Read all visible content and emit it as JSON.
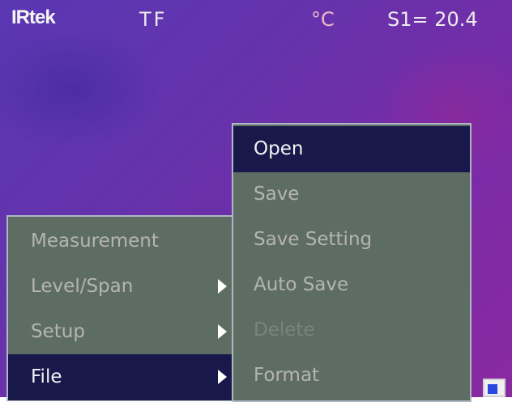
{
  "hud": {
    "logo": "IRtek",
    "mode": "TF",
    "unit": "°C",
    "spot_reading": "S1= 20.4"
  },
  "main_menu": {
    "items": [
      {
        "label": "Measurement",
        "has_submenu": false,
        "selected": false
      },
      {
        "label": "Level/Span",
        "has_submenu": true,
        "selected": false
      },
      {
        "label": "Setup",
        "has_submenu": true,
        "selected": false
      },
      {
        "label": "File",
        "has_submenu": true,
        "selected": true
      }
    ]
  },
  "file_submenu": {
    "items": [
      {
        "label": "Open",
        "selected": true,
        "enabled": true
      },
      {
        "label": "Save",
        "selected": false,
        "enabled": true
      },
      {
        "label": "Save Setting",
        "selected": false,
        "enabled": true
      },
      {
        "label": "Auto Save",
        "selected": false,
        "enabled": true
      },
      {
        "label": "Delete",
        "selected": false,
        "enabled": false
      },
      {
        "label": "Format",
        "selected": false,
        "enabled": true
      }
    ]
  },
  "colors": {
    "menu_background": "#5e6d63",
    "menu_border": "#aeb8c4",
    "selection_background": "#19184b",
    "text_normal": "#b4b4b4",
    "text_selected": "#f2f2f2",
    "text_disabled": "#76847b",
    "thermal_base": "#6a33ad"
  },
  "icons": {
    "submenu_arrow": "triangle-right-icon",
    "status_indicator": "battery-icon"
  }
}
